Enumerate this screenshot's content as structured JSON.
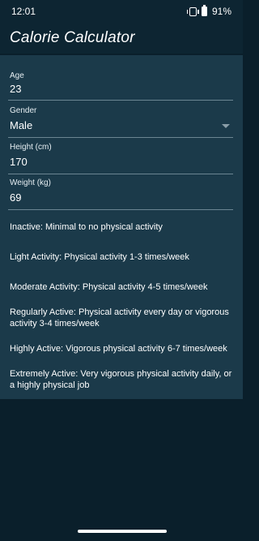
{
  "status": {
    "time": "12:01",
    "battery": "91%"
  },
  "app": {
    "title": "Calorie Calculator"
  },
  "form": {
    "age": {
      "label": "Age",
      "value": "23"
    },
    "gender": {
      "label": "Gender",
      "value": "Male"
    },
    "height": {
      "label": "Height (cm)",
      "value": "170"
    },
    "weight": {
      "label": "Weight (kg)",
      "value": "69"
    }
  },
  "activities": [
    "Inactive: Minimal to no physical activity",
    "Light Activity: Physical activity 1-3 times/week",
    "Moderate Activity: Physical activity 4-5 times/week",
    "Regularly Active: Physical activity every day or vigorous activity 3-4 times/week",
    "Highly Active: Vigorous physical activity 6-7 times/week",
    "Extremely Active: Very vigorous physical activity daily, or a highly physical job"
  ],
  "icons": {
    "vibrate": "vibrate-icon",
    "battery": "battery-icon",
    "dropdown": "chevron-down-icon"
  },
  "colors": {
    "background": "#0a1f2b",
    "app_bar": "#0d2532",
    "panel": "#1b3a4a"
  }
}
